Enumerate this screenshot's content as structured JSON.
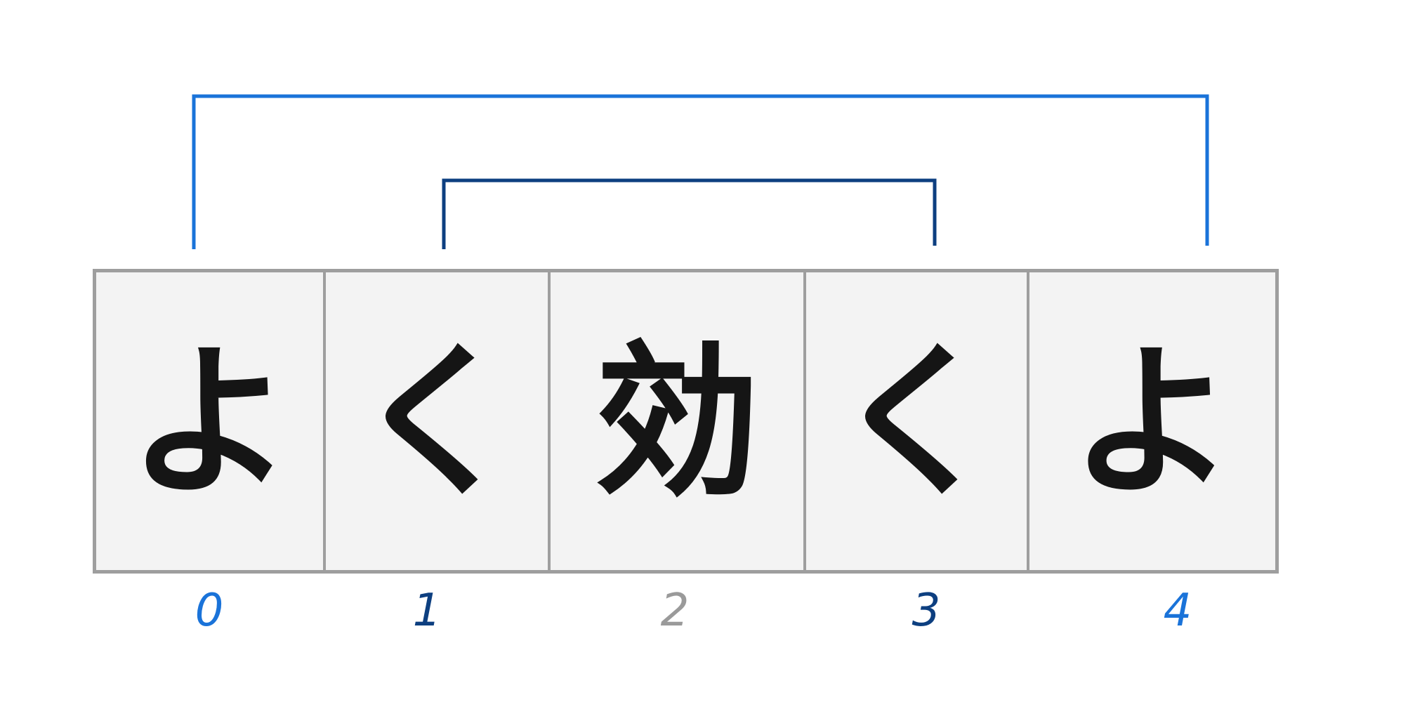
{
  "cells": [
    {
      "char": "よ",
      "index": "0",
      "color": "#1a73d9"
    },
    {
      "char": "く",
      "index": "1",
      "color": "#0d3f80"
    },
    {
      "char": "効",
      "index": "2",
      "color": "#9a9a9a"
    },
    {
      "char": "く",
      "index": "3",
      "color": "#0d3f80"
    },
    {
      "char": "よ",
      "index": "4",
      "color": "#1a73d9"
    }
  ],
  "pairs": [
    {
      "from": "0",
      "to": "4",
      "color": "#1a73d9"
    },
    {
      "from": "1",
      "to": "3",
      "color": "#0d3f80"
    }
  ]
}
